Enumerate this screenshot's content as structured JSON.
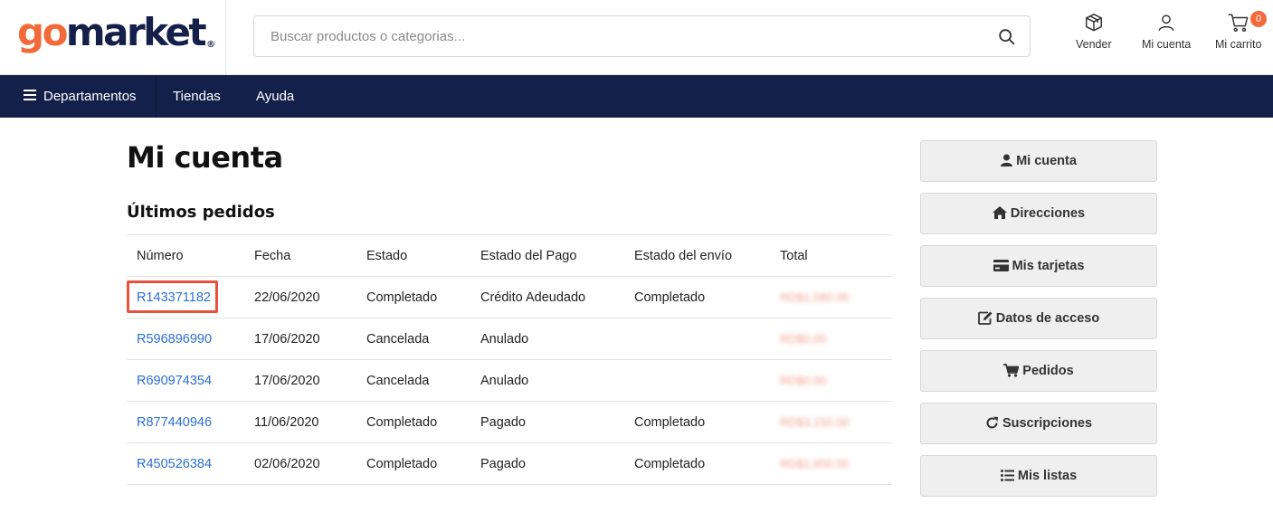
{
  "header": {
    "logo": {
      "go": "go",
      "market": "market",
      "reg": "®"
    },
    "search_placeholder": "Buscar productos o categorias...",
    "actions": {
      "sell": "Vender",
      "account": "Mi cuenta",
      "cart": "Mi carrito",
      "cart_count": "0"
    }
  },
  "nav": {
    "departments": "Departamentos",
    "stores": "Tiendas",
    "help": "Ayuda"
  },
  "main": {
    "title": "Mi cuenta",
    "section_title": "Últimos pedidos",
    "table": {
      "columns": [
        "Número",
        "Fecha",
        "Estado",
        "Estado del Pago",
        "Estado del envío",
        "Total"
      ],
      "rows": [
        {
          "number": "R143371182",
          "date": "22/06/2020",
          "status": "Completado",
          "payment": "Crédito Adeudado",
          "shipping": "Completado",
          "total": "RD$1,580.00"
        },
        {
          "number": "R596896990",
          "date": "17/06/2020",
          "status": "Cancelada",
          "payment": "Anulado",
          "shipping": "",
          "total": "RD$0.00"
        },
        {
          "number": "R690974354",
          "date": "17/06/2020",
          "status": "Cancelada",
          "payment": "Anulado",
          "shipping": "",
          "total": "RD$0.00"
        },
        {
          "number": "R877440946",
          "date": "11/06/2020",
          "status": "Completado",
          "payment": "Pagado",
          "shipping": "Completado",
          "total": "RD$3,150.00"
        },
        {
          "number": "R450526384",
          "date": "02/06/2020",
          "status": "Completado",
          "payment": "Pagado",
          "shipping": "Completado",
          "total": "RD$1,950.00"
        }
      ]
    }
  },
  "sidebar": {
    "items": [
      {
        "label": "Mi cuenta",
        "icon": "user-icon"
      },
      {
        "label": "Direcciones",
        "icon": "home-icon"
      },
      {
        "label": "Mis tarjetas",
        "icon": "credit-card-icon"
      },
      {
        "label": "Datos de acceso",
        "icon": "edit-icon"
      },
      {
        "label": "Pedidos",
        "icon": "cart-icon"
      },
      {
        "label": "Suscripciones",
        "icon": "refresh-icon"
      },
      {
        "label": "Mis listas",
        "icon": "list-icon"
      }
    ]
  },
  "colors": {
    "brand_orange": "#f26a3a",
    "brand_navy": "#14204a",
    "link_blue": "#2c6fd1",
    "highlight_red": "#e8513b"
  }
}
